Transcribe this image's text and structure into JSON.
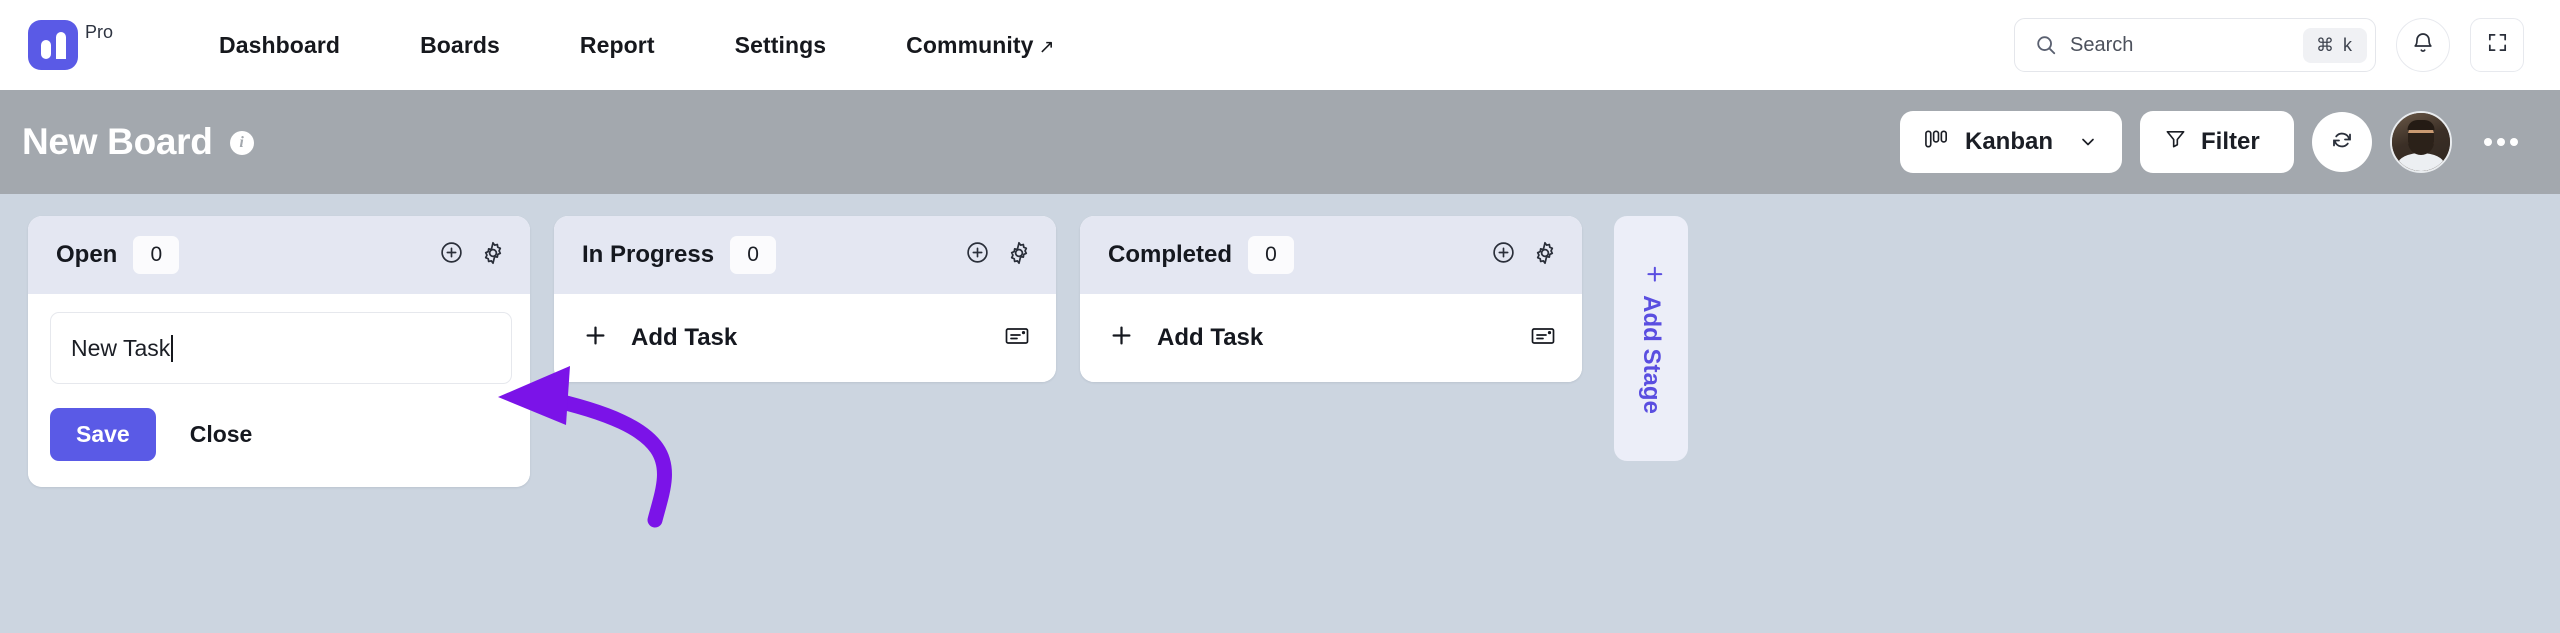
{
  "topnav": {
    "brand": {
      "logo_icon": "kanban-logo-icon",
      "plan_label": "Pro"
    },
    "links": [
      {
        "label": "Dashboard",
        "external": false
      },
      {
        "label": "Boards",
        "external": false
      },
      {
        "label": "Report",
        "external": false
      },
      {
        "label": "Settings",
        "external": false
      },
      {
        "label": "Community",
        "external": true,
        "external_glyph": "↗"
      }
    ],
    "search": {
      "icon": "search-icon",
      "placeholder": "Search",
      "shortcut": "⌘ k"
    },
    "notifications_icon": "bell-icon",
    "fullscreen_icon": "fullscreen-icon"
  },
  "boardbar": {
    "title": "New Board",
    "info_icon": "info-icon",
    "view_selector": {
      "icon": "kanban-view-icon",
      "label": "Kanban",
      "chevron": "chevron-down-icon"
    },
    "filter": {
      "icon": "filter-icon",
      "label": "Filter"
    },
    "refresh_icon": "refresh-icon",
    "avatar": "user-avatar",
    "more_icon": "more-options-icon"
  },
  "columns": [
    {
      "name": "Open",
      "count": "0",
      "add_icon": "plus-circle-icon",
      "settings_icon": "gear-icon",
      "editor": {
        "value": "New Task",
        "placeholder": "New Task",
        "save_label": "Save",
        "close_label": "Close"
      }
    },
    {
      "name": "In Progress",
      "count": "0",
      "add_icon": "plus-circle-icon",
      "settings_icon": "gear-icon",
      "add_task": {
        "icon": "plus-icon",
        "label": "Add Task",
        "template_icon": "card-template-icon"
      }
    },
    {
      "name": "Completed",
      "count": "0",
      "add_icon": "plus-circle-icon",
      "settings_icon": "gear-icon",
      "add_task": {
        "icon": "plus-icon",
        "label": "Add Task",
        "template_icon": "card-template-icon"
      }
    }
  ],
  "add_stage": {
    "icon": "plus-icon",
    "label": "Add Stage"
  },
  "annotation": {
    "type": "curved-arrow",
    "color": "#7b13e8",
    "points_to": "new-task-input"
  },
  "colors": {
    "accent": "#5a5ae6",
    "page_background": "#ccd5e0",
    "board_header": "#a3a8ae",
    "column_header": "#e4e7f2",
    "add_stage_text": "#5a4ee0",
    "annotation": "#7b13e8"
  }
}
